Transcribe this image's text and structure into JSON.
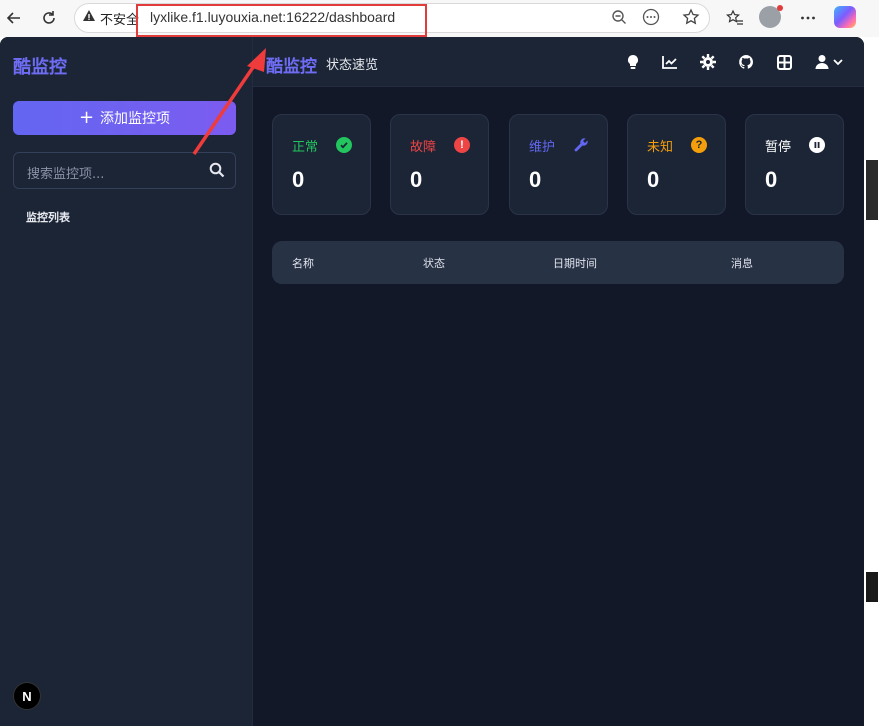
{
  "browser": {
    "insecure_label": "不安全",
    "url": "lyxlike.f1.luyouxia.net:16222/dashboard"
  },
  "app": {
    "logo": "酷监控",
    "add_button": "添加监控项",
    "search_placeholder": "搜索监控项...",
    "list_label": "监控列表",
    "topbar_logo": "酷监控",
    "topbar_title": "状态速览",
    "next_badge": "N"
  },
  "cards": [
    {
      "label": "正常",
      "value": "0",
      "color": "#22c55e",
      "icon": "check-circle-icon"
    },
    {
      "label": "故障",
      "value": "0",
      "color": "#ef4444",
      "icon": "alert-circle-icon"
    },
    {
      "label": "维护",
      "value": "0",
      "color": "#6366f1",
      "icon": "wrench-icon"
    },
    {
      "label": "未知",
      "value": "0",
      "color": "#f59e0b",
      "icon": "question-circle-icon"
    },
    {
      "label": "暂停",
      "value": "0",
      "color": "#ffffff",
      "icon": "pause-circle-icon"
    }
  ],
  "table": {
    "columns": [
      "名称",
      "状态",
      "日期时间",
      "消息"
    ]
  }
}
